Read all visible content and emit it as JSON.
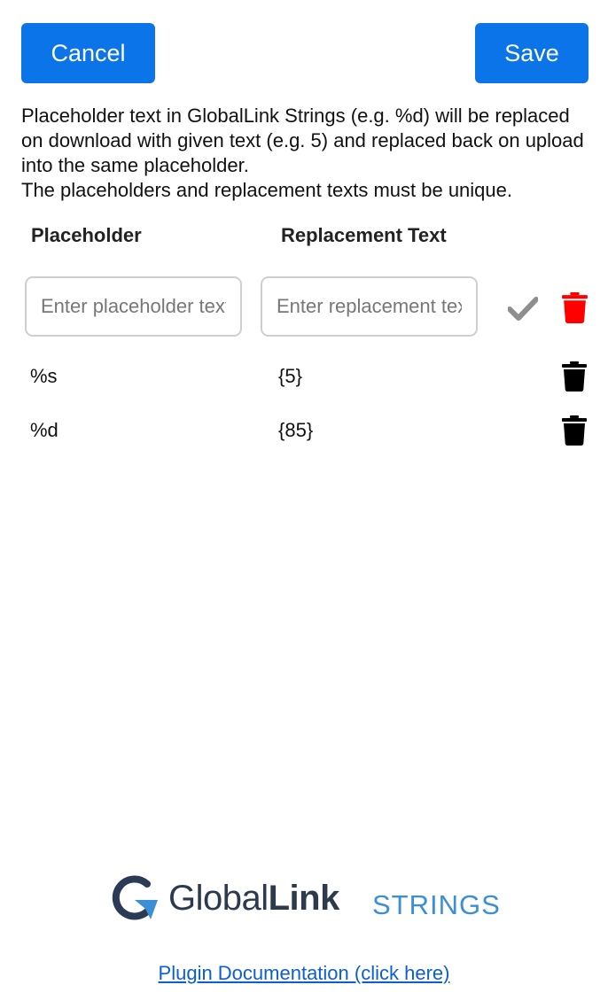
{
  "actions": {
    "cancel_label": "Cancel",
    "save_label": "Save"
  },
  "description": {
    "lines": [
      "Placeholder text in GlobalLink Strings (e.g. %d) will be replaced on download with given text (e.g. 5) and replaced back on upload into the same placeholder.",
      "The placeholders and replacement texts must be unique."
    ]
  },
  "table": {
    "headers": {
      "placeholder": "Placeholder",
      "replacement": "Replacement Text"
    },
    "new_row": {
      "placeholder_input": {
        "value": "",
        "placeholder": "Enter placeholder text"
      },
      "replacement_input": {
        "value": "",
        "placeholder": "Enter replacement text"
      },
      "confirm_icon": "check-icon",
      "delete_icon": "trash-icon",
      "delete_color": "#ff0000"
    },
    "rows": [
      {
        "placeholder": "%s",
        "replacement": "{5}",
        "delete_icon": "trash-icon"
      },
      {
        "placeholder": "%d",
        "replacement": "{85}",
        "delete_icon": "trash-icon"
      }
    ]
  },
  "footer": {
    "logo": {
      "brand": "Global",
      "brand_bold": "Link",
      "product": "STRINGS"
    },
    "doc_link": "Plugin Documentation (click here)"
  },
  "colors": {
    "primary": "#0a74e8",
    "danger": "#ff0000",
    "link": "#0b5fcf",
    "check": "#8e8e8e"
  }
}
